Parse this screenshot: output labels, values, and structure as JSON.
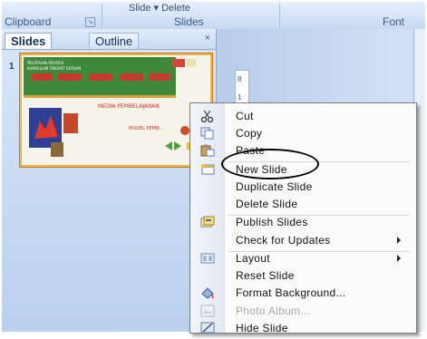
{
  "ribbon": {
    "top_text": "Slide ▾ Delete",
    "groups": [
      "Clipboard",
      "Slides",
      "Font"
    ]
  },
  "pane": {
    "tabs": [
      "Slides",
      "Outline"
    ],
    "close_glyph": "×",
    "thumb_number": "1"
  },
  "thumbnail": {
    "header_lines": [
      "PELATIHAN PROFESI",
      "KURIKULUM TINGKAT SATUAN"
    ],
    "title_text": "MEDIA PEMBELAJARAN",
    "subtitle_text": "MODEL PEMB..."
  },
  "ruler": {
    "ticks": [
      "8",
      "1"
    ]
  },
  "context_menu": {
    "items": [
      {
        "label": "Cut",
        "icon": "scissors-icon"
      },
      {
        "label": "Copy",
        "icon": "copy-icon"
      },
      {
        "label": "Paste",
        "icon": "paste-icon"
      },
      {
        "label": "New Slide",
        "icon": "new-slide-icon"
      },
      {
        "label": "Duplicate Slide",
        "icon": ""
      },
      {
        "label": "Delete Slide",
        "icon": ""
      },
      {
        "label": "Publish Slides",
        "icon": "publish-slides-icon"
      },
      {
        "label": "Check for Updates",
        "icon": "",
        "submenu": true
      },
      {
        "label": "Layout",
        "icon": "layout-icon",
        "submenu": true
      },
      {
        "label": "Reset Slide",
        "icon": ""
      },
      {
        "label": "Format Background...",
        "icon": "format-background-icon"
      },
      {
        "label": "Photo Album...",
        "icon": "photo-album-icon",
        "disabled": true
      },
      {
        "label": "Hide Slide",
        "icon": "hide-slide-icon"
      }
    ]
  },
  "colors": {
    "ribbon": "#c6d9f1",
    "pane": "#c9dcf3",
    "thumb_border": "#f0b34a",
    "thumb_header": "#3f8a3a",
    "menu_bg": "#fbfbfb",
    "highlight_oval": "#000000"
  }
}
